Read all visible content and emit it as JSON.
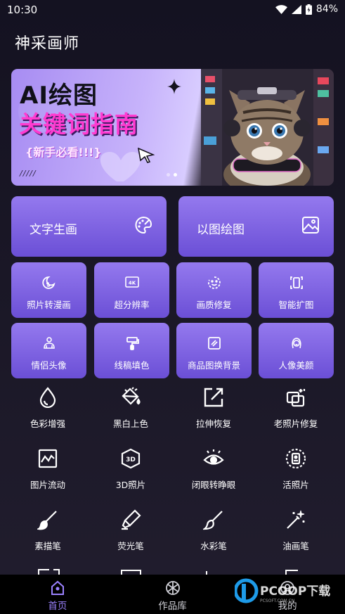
{
  "status_bar": {
    "time": "10:30",
    "battery": "84%"
  },
  "app": {
    "title": "神采画师"
  },
  "banner": {
    "title_line1": "AI绘图",
    "title_line2": "关键词指南",
    "tag": "{新手必看!!!}",
    "dots": 2,
    "active_dot": 1
  },
  "feature_cards": [
    {
      "label": "文字生画",
      "icon": "palette-icon"
    },
    {
      "label": "以图绘图",
      "icon": "image-icon"
    }
  ],
  "quick_tools": [
    {
      "label": "照片转漫画",
      "icon": "moon-face-icon"
    },
    {
      "label": "超分辨率",
      "icon": "4k-icon"
    },
    {
      "label": "画质修复",
      "icon": "smile-circle-icon"
    },
    {
      "label": "智能扩图",
      "icon": "expand-frame-icon"
    },
    {
      "label": "情侣头像",
      "icon": "couple-icon"
    },
    {
      "label": "线稿填色",
      "icon": "paint-roller-icon"
    },
    {
      "label": "商品图换背景",
      "icon": "stripes-frame-icon"
    },
    {
      "label": "人像美颜",
      "icon": "portrait-icon"
    }
  ],
  "tools": [
    {
      "label": "色彩增强",
      "icon": "drop-icon"
    },
    {
      "label": "黑白上色",
      "icon": "paint-bucket-icon"
    },
    {
      "label": "拉伸恢复",
      "icon": "resize-arrow-icon"
    },
    {
      "label": "老照片修复",
      "icon": "photo-repair-icon"
    },
    {
      "label": "图片流动",
      "icon": "wave-chart-icon"
    },
    {
      "label": "3D照片",
      "icon": "3d-icon"
    },
    {
      "label": "闭眼转睁眼",
      "icon": "eye-icon"
    },
    {
      "label": "活照片",
      "icon": "live-photo-icon"
    },
    {
      "label": "素描笔",
      "icon": "brush-icon"
    },
    {
      "label": "荧光笔",
      "icon": "highlighter-icon"
    },
    {
      "label": "水彩笔",
      "icon": "watercolor-brush-icon"
    },
    {
      "label": "油画笔",
      "icon": "magic-wand-icon"
    }
  ],
  "bottom_nav": [
    {
      "label": "首页",
      "icon": "home-icon",
      "active": true
    },
    {
      "label": "作品库",
      "icon": "gallery-icon",
      "active": false
    },
    {
      "label": "我的",
      "icon": "profile-icon",
      "active": false
    }
  ],
  "watermark": {
    "text": "PCOOP下载",
    "sub": "PCSOFT.COM.CN"
  },
  "colors": {
    "accent": "#9b82ff",
    "card_top": "#9479ee",
    "card_bottom": "#6b4fd6",
    "background": "#1a1726"
  }
}
